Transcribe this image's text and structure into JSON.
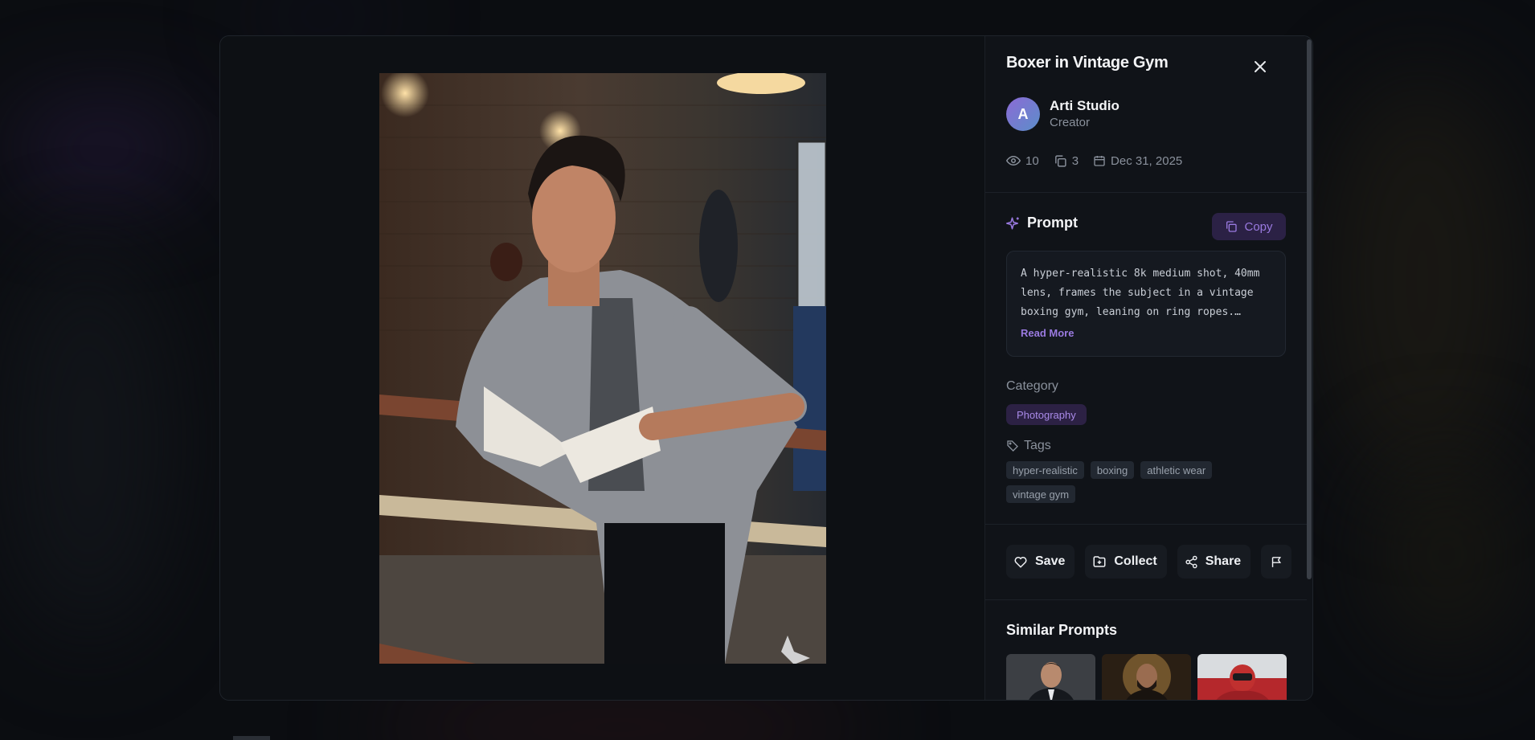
{
  "modal": {
    "title": "Boxer in Vintage Gym",
    "creator": {
      "initial": "A",
      "name": "Arti Studio",
      "role": "Creator"
    },
    "stats": {
      "views": "10",
      "copies": "3",
      "date": "Dec 31, 2025"
    },
    "prompt": {
      "label": "Prompt",
      "copy_label": "Copy",
      "text": "A hyper-realistic 8k medium shot, 40mm lens, frames the subject in a vintage boxing gym, leaning on ring ropes.…",
      "read_more": "Read More"
    },
    "category": {
      "label": "Category",
      "value": "Photography"
    },
    "tags": {
      "label": "Tags",
      "items": [
        "hyper-realistic",
        "boxing",
        "athletic wear",
        "vintage gym"
      ]
    },
    "actions": {
      "save": "Save",
      "collect": "Collect",
      "share": "Share"
    },
    "similar": {
      "title": "Similar Prompts"
    }
  },
  "colors": {
    "accent": "#9a7ae0",
    "accent_bg": "#2b2145",
    "panel_bg": "#101318",
    "page_bg": "#0b0d11"
  }
}
